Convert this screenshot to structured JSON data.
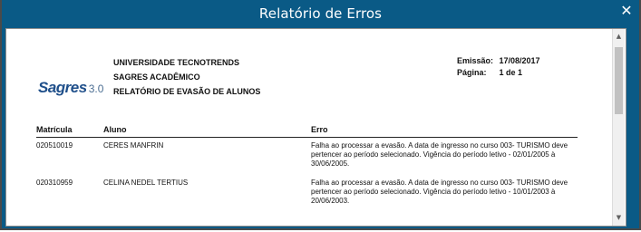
{
  "window": {
    "title": "Relatório de Erros",
    "close_icon": "close-icon"
  },
  "report": {
    "logo_text": "Sagres",
    "logo_version": "3.0",
    "institution": "UNIVERSIDADE TECNOTRENDS",
    "system": "SAGRES ACADÊMICO",
    "report_name": "RELATÓRIO DE EVASÃO DE ALUNOS",
    "emission_label": "Emissão:",
    "emission_value": "17/08/2017",
    "page_label": "Página:",
    "page_value": "1 de 1",
    "columns": {
      "matricula": "Matrícula",
      "aluno": "Aluno",
      "erro": "Erro"
    },
    "rows": [
      {
        "matricula": "020510019",
        "aluno": "CERES MANFRIN",
        "erro": "Falha ao processar a evasão. A data de ingresso no curso 003- TURISMO deve pertencer ao período selecionado. Vigência do período letivo - 02/01/2005 à 30/06/2005."
      },
      {
        "matricula": "020310959",
        "aluno": "CELINA NEDEL TERTIUS",
        "erro": "Falha ao processar a evasão. A data de ingresso no curso 003- TURISMO deve pertencer ao período selecionado. Vigência do período letivo - 10/01/2003 à 20/06/2003."
      }
    ]
  }
}
